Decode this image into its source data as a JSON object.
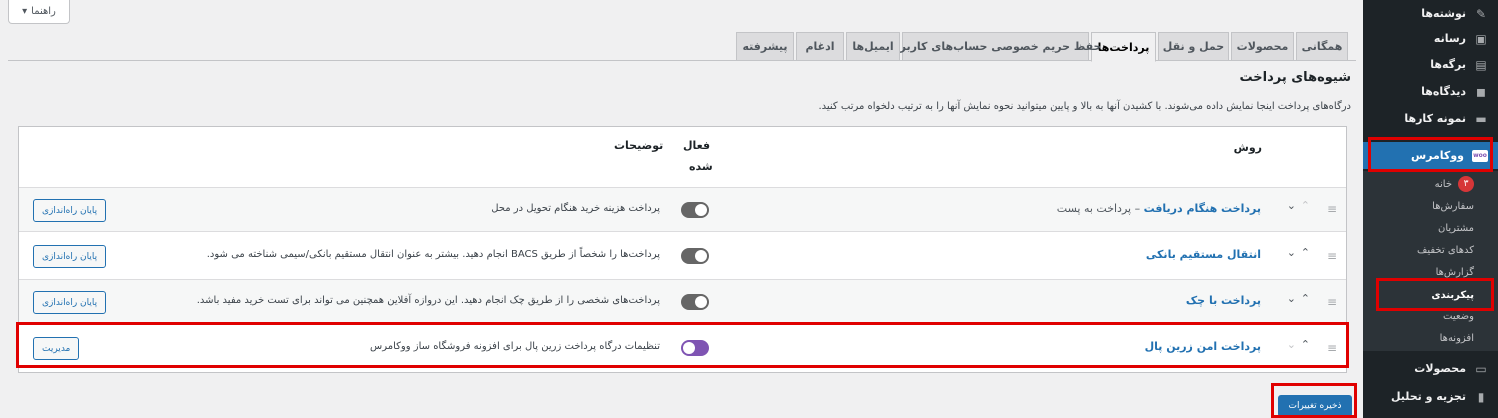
{
  "sidebar": {
    "items": [
      {
        "label": "نوشته‌ها",
        "icon": "pin-icon"
      },
      {
        "label": "رسانه",
        "icon": "media-icon"
      },
      {
        "label": "برگه‌ها",
        "icon": "page-icon"
      },
      {
        "label": "دیدگاه‌ها",
        "icon": "comment-icon"
      },
      {
        "label": "نمونه کارها",
        "icon": "portfolio-icon"
      },
      {
        "label": "ووکامرس",
        "icon": "woo-icon",
        "logo_text": "woo"
      },
      {
        "label": "محصولات",
        "icon": "products-icon"
      },
      {
        "label": "تجزیه و تحلیل",
        "icon": "analytics-icon"
      }
    ],
    "submenu": [
      {
        "label": "خانه",
        "badge": "۳"
      },
      {
        "label": "سفارش‌ها"
      },
      {
        "label": "مشتریان"
      },
      {
        "label": "کدهای تخفیف"
      },
      {
        "label": "گزارش‌ها"
      },
      {
        "label": "پیکربندی"
      },
      {
        "label": "وضعیت"
      },
      {
        "label": "افزونه‌ها"
      }
    ]
  },
  "help": {
    "label": "راهنما",
    "arrow": "▾"
  },
  "tabs": [
    "همگانی",
    "محصولات",
    "حمل و نقل",
    "پرداخت‌ها",
    "حفظ حریم خصوصی حساب‌های کاربری",
    "ایمیل‌ها",
    "ادغام",
    "پیشرفته"
  ],
  "section": {
    "title": "شیوه‌های پرداخت",
    "description": "درگاه‌های پرداخت اینجا نمایش داده می‌شوند. با کشیدن آنها به بالا و پایین میتوانید نحوه نمایش آنها را به ترتیب دلخواه مرتب کنید."
  },
  "table": {
    "headers": {
      "method": "روش",
      "enabled": "فعال",
      "enabled2": "شده",
      "description": "توضیحات"
    },
    "rows": [
      {
        "name": "پرداخت هنگام دریافت",
        "sub": " – پرداخت به پست",
        "enabled": true,
        "description": "پرداخت هزینه خرید هنگام تحویل در محل",
        "action": "پایان راه‌اندازی"
      },
      {
        "name": "انتقال مستقیم بانکی",
        "sub": "",
        "enabled": true,
        "description": "پرداخت‌ها را شخصاً از طریق BACS انجام دهید. بیشتر به عنوان انتقال مستقیم بانکی/سیمی شناخته می شود.",
        "action": "پایان راه‌اندازی"
      },
      {
        "name": "پرداخت با چک",
        "sub": "",
        "enabled": true,
        "description": "پرداخت‌های شخصی را از طریق چک انجام دهید. این دروازه آفلاین همچنین می تواند برای تست خرید مفید باشد.",
        "action": "پایان راه‌اندازی"
      },
      {
        "name": "پرداخت امن زرین پال",
        "sub": "",
        "enabled": false,
        "description": "تنظیمات درگاه پرداخت زرین پال برای افزونه فروشگاه ساز ووکامرس",
        "action": "مدیریت"
      }
    ]
  },
  "save": {
    "label": "ذخیره تغییرات"
  },
  "glyphs": {
    "drag": "≡",
    "down": "⌄",
    "up": "⌃"
  },
  "colors": {
    "accent": "#2271b1",
    "highlight": "#e00000",
    "woo": "#7f54b3"
  }
}
